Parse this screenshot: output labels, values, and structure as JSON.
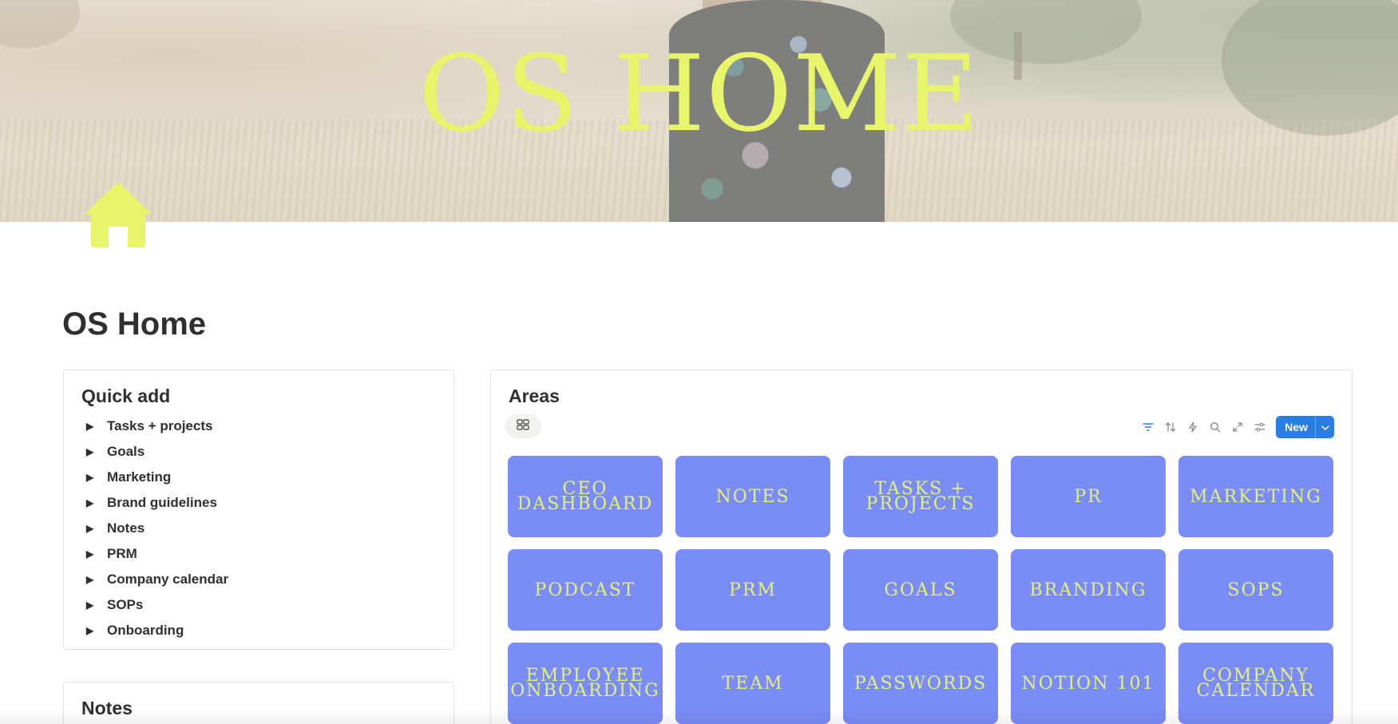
{
  "cover": {
    "title": "OS HOME",
    "title_color": "#e8f46a"
  },
  "page_icon": {
    "name": "house-icon",
    "color": "#e8f46a"
  },
  "page_title": "OS Home",
  "quick_add": {
    "heading": "Quick add",
    "caret": "▶",
    "items": [
      {
        "label": "Tasks + projects"
      },
      {
        "label": "Goals"
      },
      {
        "label": "Marketing"
      },
      {
        "label": "Brand guidelines"
      },
      {
        "label": "Notes"
      },
      {
        "label": "PRM"
      },
      {
        "label": "Company calendar"
      },
      {
        "label": "SOPs"
      },
      {
        "label": "Onboarding"
      }
    ]
  },
  "notes": {
    "heading": "Notes"
  },
  "areas": {
    "heading": "Areas",
    "view_icon": "gallery-view-icon",
    "toolbar_icons": [
      "filter-icon",
      "sort-icon",
      "automation-icon",
      "search-icon",
      "expand-icon",
      "settings-icon"
    ],
    "new_button": "New",
    "tile_color": "#7a8cf8",
    "tile_text_color": "#e5f07a",
    "tiles": [
      {
        "label": "CEO\nDASHBOARD"
      },
      {
        "label": "NOTES"
      },
      {
        "label": "TASKS +\nPROJECTS"
      },
      {
        "label": "PR"
      },
      {
        "label": "MARKETING"
      },
      {
        "label": "PODCAST"
      },
      {
        "label": "PRM"
      },
      {
        "label": "GOALS"
      },
      {
        "label": "BRANDING"
      },
      {
        "label": "SOPS"
      },
      {
        "label": "EMPLOYEE\nONBOARDING"
      },
      {
        "label": "TEAM"
      },
      {
        "label": "PASSWORDS"
      },
      {
        "label": "NOTION 101"
      },
      {
        "label": "COMPANY\nCALENDAR"
      }
    ]
  }
}
